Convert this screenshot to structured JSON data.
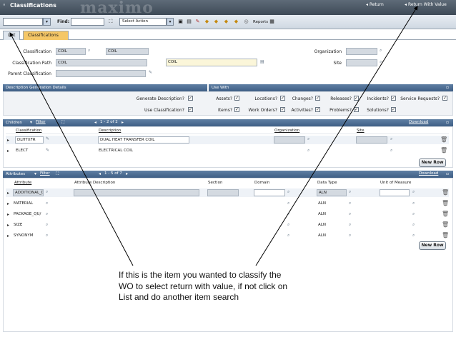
{
  "titlebar": {
    "app_title": "Classifications",
    "watermark": "maximo",
    "return_label": "Return",
    "return_value_label": "Return With Value"
  },
  "toolbar": {
    "find_label": "Find:",
    "select_action": "Select Action",
    "reports_label": "Reports"
  },
  "tabs": [
    {
      "label": "List"
    },
    {
      "label": "Classifications"
    }
  ],
  "form": {
    "classification_label": "Classification",
    "classification_value": "COIL",
    "classification_desc": "COIL",
    "path_label": "Classification Path",
    "path_value": "COIL",
    "path_desc": "COIL",
    "parent_label": "Parent Classification",
    "organization_label": "Organization",
    "site_label": "Site"
  },
  "description_generation": {
    "title": "Description Generation Details",
    "generate_label": "Generate Description?",
    "use_label": "Use Classification?"
  },
  "use_with": {
    "title": "Use With",
    "items": [
      {
        "label": "Assets?",
        "row": 1
      },
      {
        "label": "Locations?",
        "row": 1
      },
      {
        "label": "Changes?",
        "row": 1
      },
      {
        "label": "Releases?",
        "row": 1
      },
      {
        "label": "Incidents?",
        "row": 1
      },
      {
        "label": "Service Requests?",
        "row": 1
      },
      {
        "label": "Items?",
        "row": 2
      },
      {
        "label": "Work Orders?",
        "row": 2
      },
      {
        "label": "Activities?",
        "row": 2
      },
      {
        "label": "Problems?",
        "row": 2
      },
      {
        "label": "Solutions?",
        "row": 2
      }
    ]
  },
  "children": {
    "title": "Children",
    "filter_label": "Filter",
    "pager": "1 - 2 of 2",
    "download_label": "Download",
    "headers": [
      "Classification",
      "Description",
      "Organization",
      "Site"
    ],
    "rows": [
      {
        "classification": "DLHTXFR",
        "description": "DUAL HEAT TRANSFER COIL"
      },
      {
        "classification": "ELECT",
        "description": "ELECTRICAL COIL"
      }
    ],
    "new_row_label": "New Row"
  },
  "attributes": {
    "title": "Attributes",
    "filter_label": "Filter",
    "pager": "1 - 5 of 7",
    "download_label": "Download",
    "headers": [
      "Attribute",
      "Attribute Description",
      "Section",
      "Domain",
      "Data Type",
      "Unit of Measure"
    ],
    "rows": [
      {
        "attribute": "ADDITIONAL_DI",
        "data_type": "ALN"
      },
      {
        "attribute": "MATERIAL",
        "data_type": "ALN"
      },
      {
        "attribute": "PACKAGE_QU/",
        "data_type": "ALN"
      },
      {
        "attribute": "SIZE",
        "data_type": "ALN"
      },
      {
        "attribute": "SYNONYM",
        "data_type": "ALN"
      }
    ],
    "new_row_label": "New Row"
  },
  "callout": {
    "text": "If this is the item you wanted to classify the WO to select return with value, if not click on List and do another item search"
  },
  "colors": {
    "section_bar": "#4a6a91",
    "titlebar": "#4a5663",
    "arrow": "#000000"
  }
}
